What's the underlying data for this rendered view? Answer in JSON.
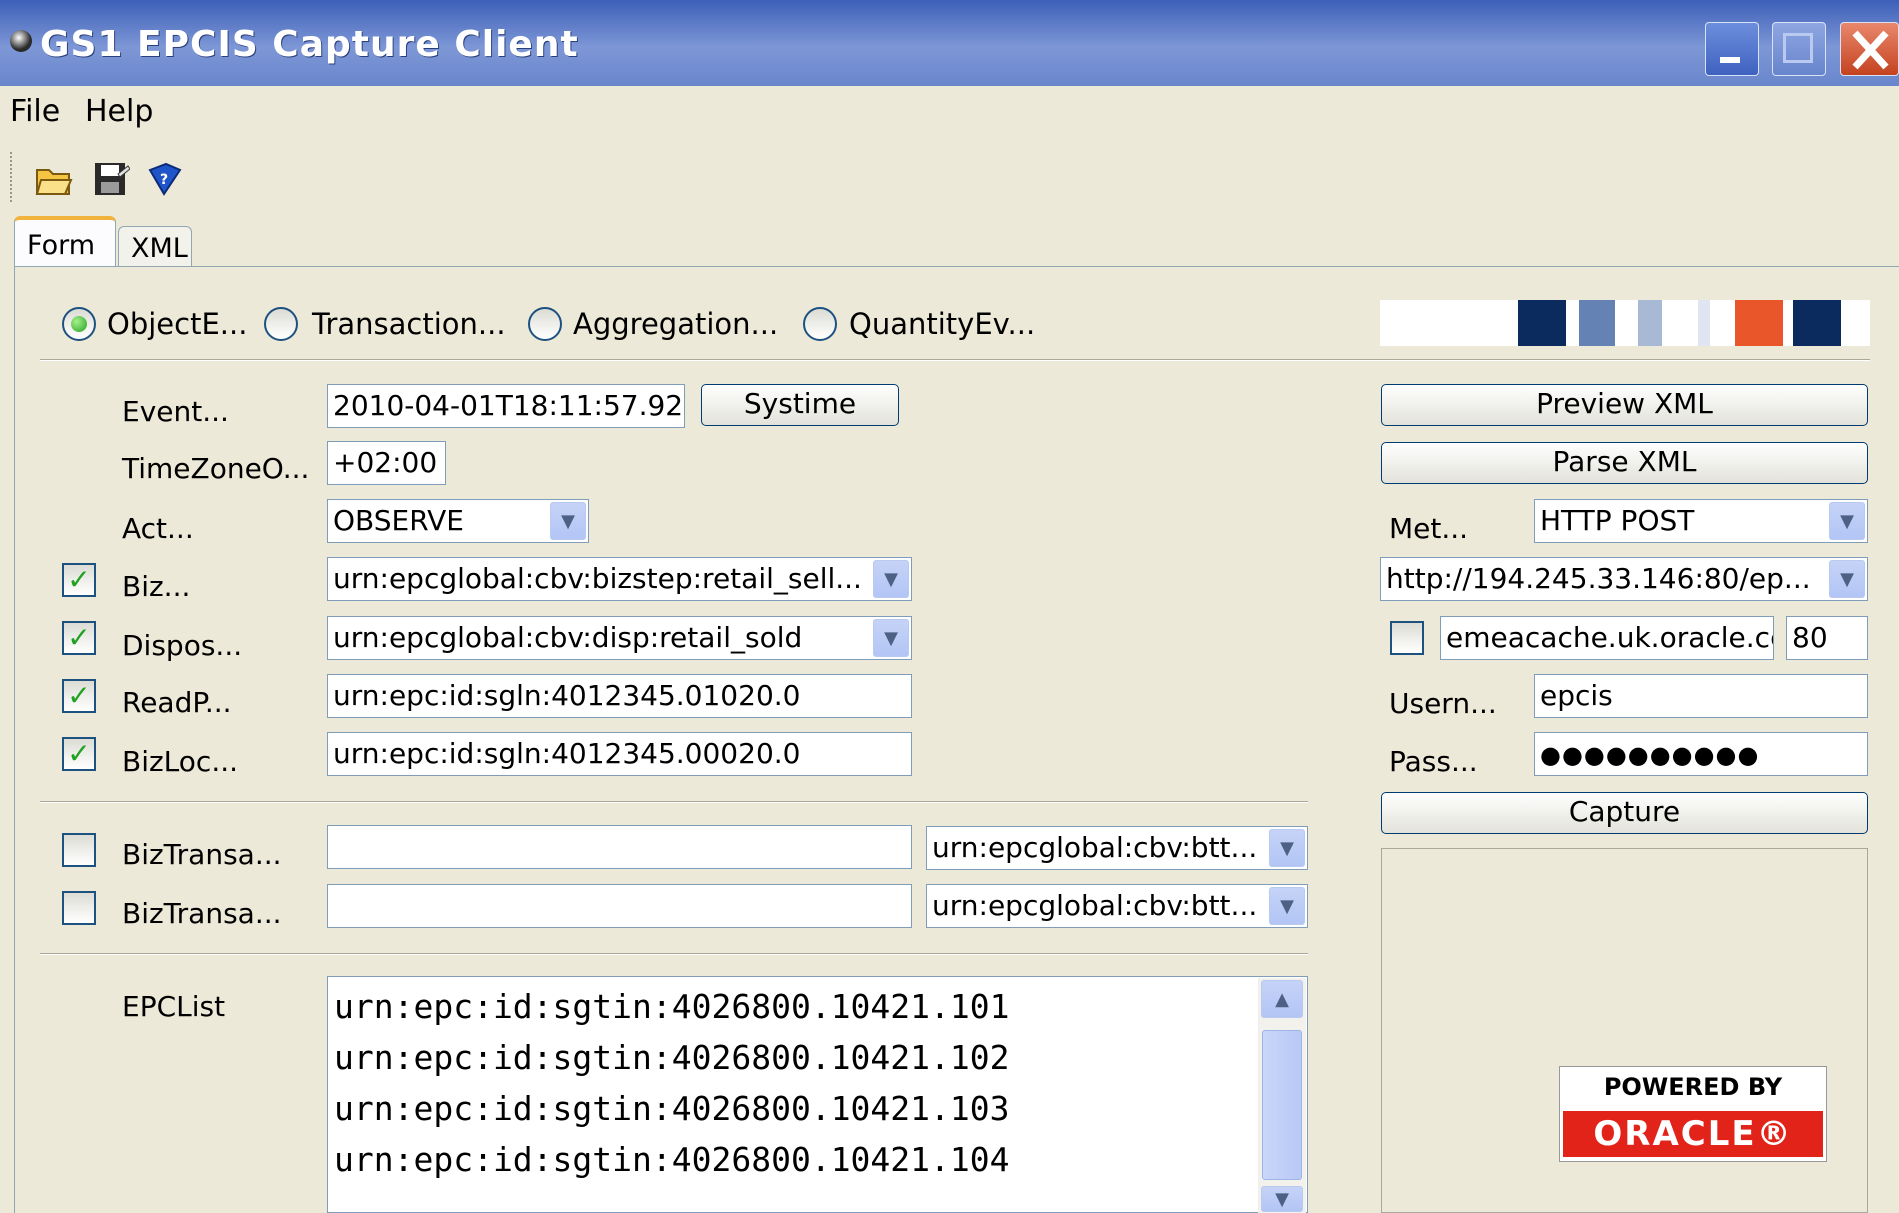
{
  "window": {
    "title": "GS1 EPCIS Capture Client"
  },
  "menu": {
    "items": [
      "File",
      "Help"
    ]
  },
  "toolbar": {
    "icons": [
      "open-folder-icon",
      "save-icon",
      "info-book-icon"
    ]
  },
  "tabs": [
    {
      "label": "Form",
      "active": true
    },
    {
      "label": "XML",
      "active": false
    }
  ],
  "event_types": [
    {
      "label": "ObjectE...",
      "selected": true
    },
    {
      "label": "Transaction...",
      "selected": false
    },
    {
      "label": "Aggregation...",
      "selected": false
    },
    {
      "label": "QuantityEv...",
      "selected": false
    }
  ],
  "brand_colors": [
    "#0b2a5e",
    "#6482b4",
    "#a8b9d6",
    "#dfe6f1",
    "#e8562a",
    "#0b2a5e"
  ],
  "form": {
    "event_time_label": "Event...",
    "event_time_value": "2010-04-01T18:11:57.92",
    "systime_label": "Systime",
    "timezone_label": "TimeZoneO...",
    "timezone_value": "+02:00",
    "action_label": "Act...",
    "action_value": "OBSERVE",
    "bizstep_label": "Biz...",
    "bizstep_value": "urn:epcglobal:cbv:bizstep:retail_sell...",
    "bizstep_checked": true,
    "disposition_label": "Dispos...",
    "disposition_value": "urn:epcglobal:cbv:disp:retail_sold",
    "disposition_checked": true,
    "readpoint_label": "ReadP...",
    "readpoint_value": "urn:epc:id:sgln:4012345.01020.0",
    "readpoint_checked": true,
    "bizloc_label": "BizLoc...",
    "bizloc_value": "urn:epc:id:sgln:4012345.00020.0",
    "bizloc_checked": true,
    "biztrans1_label": "BizTransa...",
    "biztrans1_value": "",
    "biztrans1_type": "urn:epcglobal:cbv:btt...",
    "biztrans2_label": "BizTransa...",
    "biztrans2_value": "",
    "biztrans2_type": "urn:epcglobal:cbv:btt...",
    "epclist_label": "EPCList",
    "epclist": [
      "urn:epc:id:sgtin:4026800.10421.101",
      "urn:epc:id:sgtin:4026800.10421.102",
      "urn:epc:id:sgtin:4026800.10421.103",
      "urn:epc:id:sgtin:4026800.10421.104"
    ]
  },
  "right": {
    "preview_label": "Preview XML",
    "parse_label": "Parse XML",
    "method_label": "Met...",
    "method_value": "HTTP POST",
    "url_value": "http://194.245.33.146:80/ep...",
    "proxy_host": "emeacache.uk.oracle.cc",
    "proxy_port": "80",
    "username_label": "Usern...",
    "username_value": "epcis",
    "password_label": "Pass...",
    "password_value": "●●●●●●●●●●",
    "capture_label": "Capture"
  },
  "oracle": {
    "line1": "POWERED BY",
    "line2": "ORACLE®"
  }
}
